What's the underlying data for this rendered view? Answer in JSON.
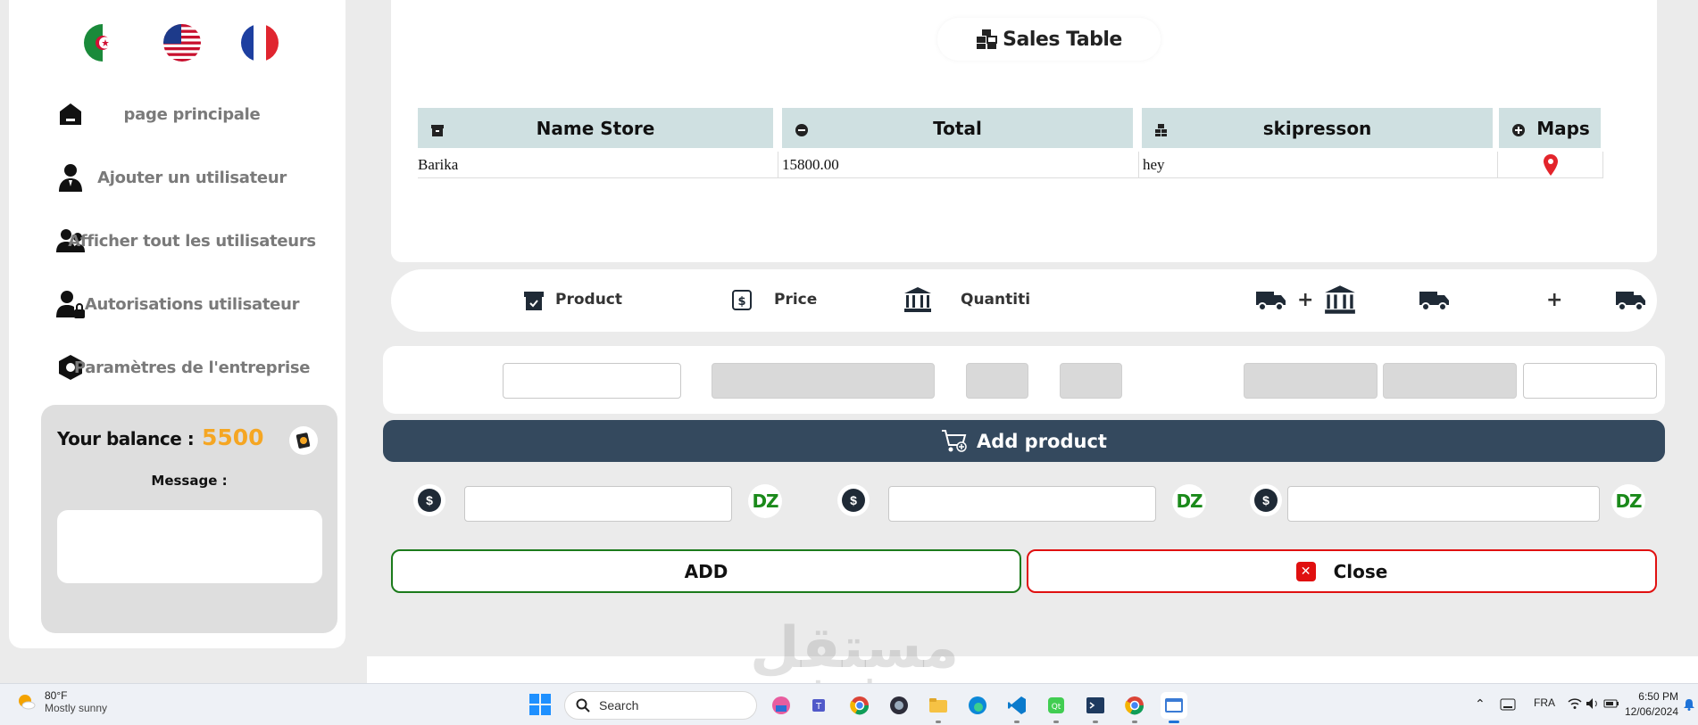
{
  "sidebar": {
    "flags": [
      "algeria-flag",
      "usa-flag",
      "france-flag"
    ],
    "items": [
      {
        "label": "page principale",
        "icon": "home-icon"
      },
      {
        "label": "Ajouter un utilisateur",
        "icon": "add-user-icon"
      },
      {
        "label": "Afficher tout les utilisateurs",
        "icon": "users-icon"
      },
      {
        "label": "Autorisations utilisateur",
        "icon": "user-lock-icon"
      },
      {
        "label": "Paramètres de l'entreprise",
        "icon": "settings-hexagon-icon"
      }
    ],
    "balance_label": "Your balance :",
    "balance_value": "5500",
    "message_label": "Message :",
    "message_value": ""
  },
  "sales_table": {
    "title": "Sales Table",
    "columns": [
      "Name Store",
      "Total",
      "skipresson",
      "Maps"
    ],
    "rows": [
      {
        "store": "Barika",
        "total": "15800.00",
        "person": "hey",
        "map": "map-pin-icon"
      }
    ]
  },
  "product_header": {
    "product": "Product",
    "price": "Price",
    "quantity": "Quantiti",
    "plus_1": "+",
    "plus_2": "+"
  },
  "add_product_label": "Add product",
  "currency_label": "DZ",
  "coin_symbol": "$",
  "buttons": {
    "add": "ADD",
    "close": "Close"
  },
  "colors": {
    "accent_dark": "#34495e",
    "balance": "#f5a623",
    "add_border": "#1b7a1b",
    "close_border": "#e01010",
    "table_header": "#cfe0e1"
  },
  "watermark": {
    "main": "مستقل",
    "sub": "mostaql.com"
  },
  "taskbar": {
    "weather_temp": "80°F",
    "weather_cond": "Mostly sunny",
    "search_placeholder": "Search",
    "language": "FRA",
    "time": "6:50 PM",
    "date": "12/06/2024"
  }
}
